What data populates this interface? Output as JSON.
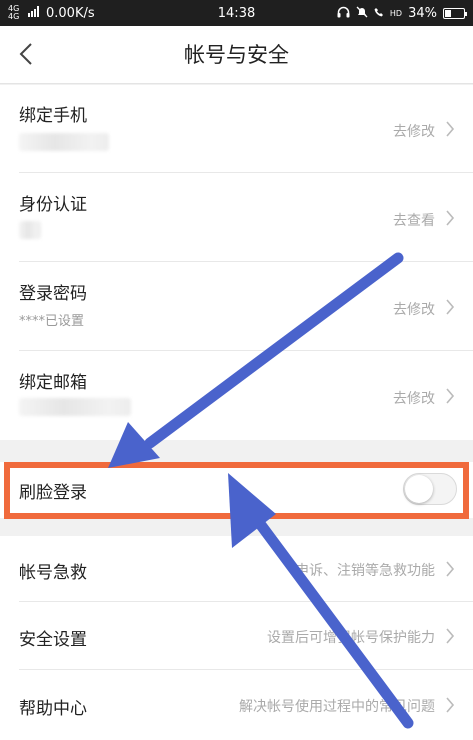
{
  "status_bar": {
    "network": "4G 4G",
    "speed": "0.00K/s",
    "time": "14:38",
    "hd": "HD",
    "battery": "34%",
    "battery_level": 0.34
  },
  "nav": {
    "title": "帐号与安全"
  },
  "rows": {
    "phone": {
      "title": "绑定手机",
      "action": "去修改"
    },
    "identity": {
      "title": "身份认证",
      "action": "去查看"
    },
    "password": {
      "title": "登录密码",
      "subtitle": "****已设置",
      "action": "去修改"
    },
    "email": {
      "title": "绑定邮箱",
      "action": "去修改"
    },
    "face_login": {
      "title": "刷脸登录",
      "enabled": false
    },
    "rescue": {
      "title": "帐号急救",
      "desc": "申诉、注销等急救功能"
    },
    "security": {
      "title": "安全设置",
      "desc": "设置后可增强帐号保护能力"
    },
    "help": {
      "title": "帮助中心",
      "desc": "解决帐号使用过程中的常见问题"
    }
  },
  "colors": {
    "highlight": "#f06a3c",
    "arrow": "#4a63cc"
  }
}
